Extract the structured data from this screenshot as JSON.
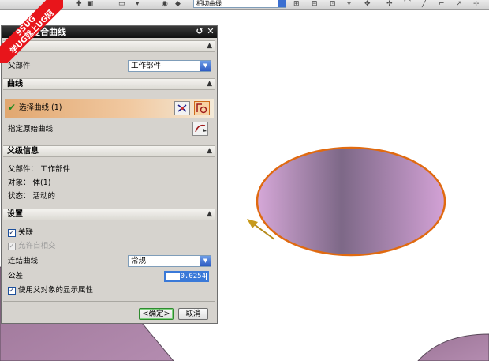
{
  "toolbar": {
    "combo_value": "相切曲线"
  },
  "watermark": {
    "line1": "9SUG",
    "line2": "学UG就上UG网"
  },
  "dialog": {
    "title": "复合曲线",
    "sections": {
      "part": {
        "header": "部件",
        "parent_part_label": "父部件",
        "parent_part_value": "工作部件"
      },
      "curve": {
        "header": "曲线",
        "select_curve_label": "选择曲线 (1)",
        "specify_origin_label": "指定原始曲线"
      },
      "parent_info": {
        "header": "父级信息",
        "line1": "父部件：  工作部件",
        "line2": "对象：  体(1)",
        "line3": "状态：  活动的"
      },
      "settings": {
        "header": "设置",
        "associative_label": "关联",
        "allow_self_intersect_label": "允许自相交",
        "join_curves_label": "连结曲线",
        "join_curves_value": "常规",
        "tolerance_label": "公差",
        "tolerance_value": "0.0254",
        "use_parent_display_label": "使用父对象的显示属性"
      }
    },
    "ok_label": "<确定>",
    "cancel_label": "取消"
  },
  "colors": {
    "accent": "#3a79d8",
    "highlight_row": "#e1a770",
    "ellipse_edge": "#e06a10"
  }
}
